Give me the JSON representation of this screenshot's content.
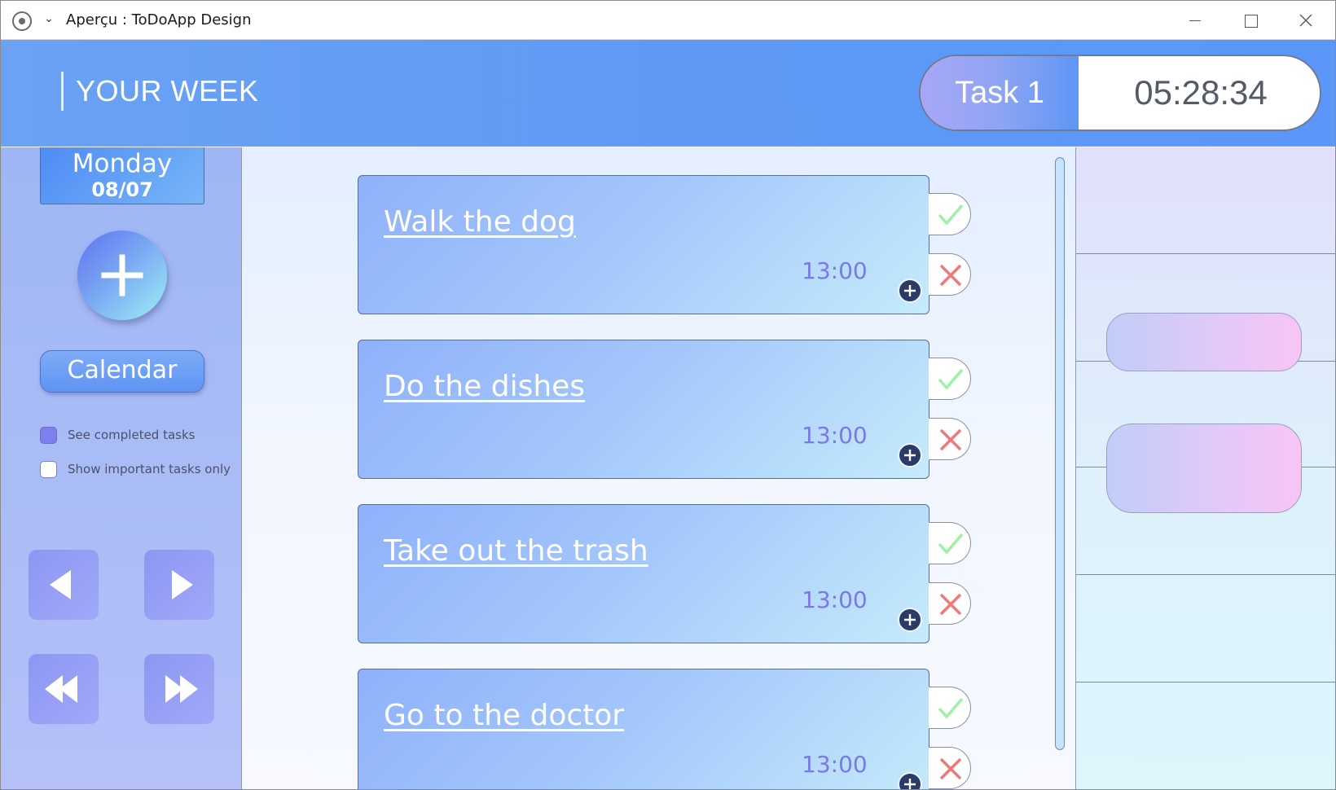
{
  "window": {
    "title": "Aperçu : ToDoApp Design"
  },
  "header": {
    "title": "YOUR WEEK",
    "current_task": "Task 1",
    "timer": "05:28:34"
  },
  "sidebar": {
    "day_name": "Monday",
    "day_date": "08/07",
    "calendar_label": "Calendar",
    "options": [
      {
        "label": "See completed tasks",
        "checked": true
      },
      {
        "label": "Show important tasks only",
        "checked": false
      }
    ],
    "nav_icons": [
      "previous-icon",
      "next-icon",
      "rewind-icon",
      "fast-forward-icon"
    ]
  },
  "tasks": [
    {
      "title": "Walk the dog",
      "time": "13:00"
    },
    {
      "title": "Do the dishes",
      "time": "13:00"
    },
    {
      "title": "Take out the trash",
      "time": "13:00"
    },
    {
      "title": "Go to the doctor",
      "time": "13:00"
    }
  ],
  "colors": {
    "header_blue": "#5d99f5",
    "check_green": "#9ef2a5",
    "cross_red": "#f07878",
    "time_purple": "#7b79e6"
  }
}
